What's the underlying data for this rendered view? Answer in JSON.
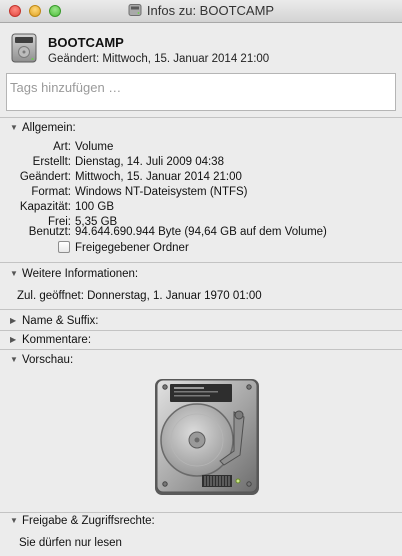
{
  "window": {
    "title": "Infos zu: BOOTCAMP"
  },
  "header": {
    "name": "BOOTCAMP",
    "modified": "Geändert: Mittwoch, 15. Januar 2014 21:00",
    "icon": "hard-drive-icon"
  },
  "tags": {
    "placeholder": "Tags hinzufügen …"
  },
  "sections": {
    "general": {
      "label": "Allgemein:",
      "expanded": true,
      "rows": [
        {
          "key": "Art:",
          "value": "Volume"
        },
        {
          "key": "Erstellt:",
          "value": "Dienstag, 14. Juli 2009 04:38"
        },
        {
          "key": "Geändert:",
          "value": "Mittwoch, 15. Januar 2014 21:00"
        },
        {
          "key": "Format:",
          "value": "Windows NT-Dateisystem (NTFS)"
        },
        {
          "key": "Kapazität:",
          "value": "100 GB"
        },
        {
          "key": "Frei:",
          "value": "5,35 GB"
        },
        {
          "key": "Benutzt:",
          "value": "94.644.690.944 Byte (94,64 GB auf dem Volume)"
        }
      ],
      "shared_folder": {
        "label": "Freigegebener Ordner",
        "checked": false
      }
    },
    "more_info": {
      "label": "Weitere Informationen:",
      "expanded": true,
      "last_opened": "Zul. geöffnet: Donnerstag, 1. Januar 1970 01:00"
    },
    "name_ext": {
      "label": "Name & Suffix:",
      "expanded": false
    },
    "comments": {
      "label": "Kommentare:",
      "expanded": false
    },
    "preview": {
      "label": "Vorschau:",
      "expanded": true,
      "icon": "hard-drive-preview-icon"
    },
    "sharing": {
      "label": "Freigabe & Zugriffsrechte:",
      "expanded": true,
      "text": "Sie dürfen nur lesen"
    }
  }
}
